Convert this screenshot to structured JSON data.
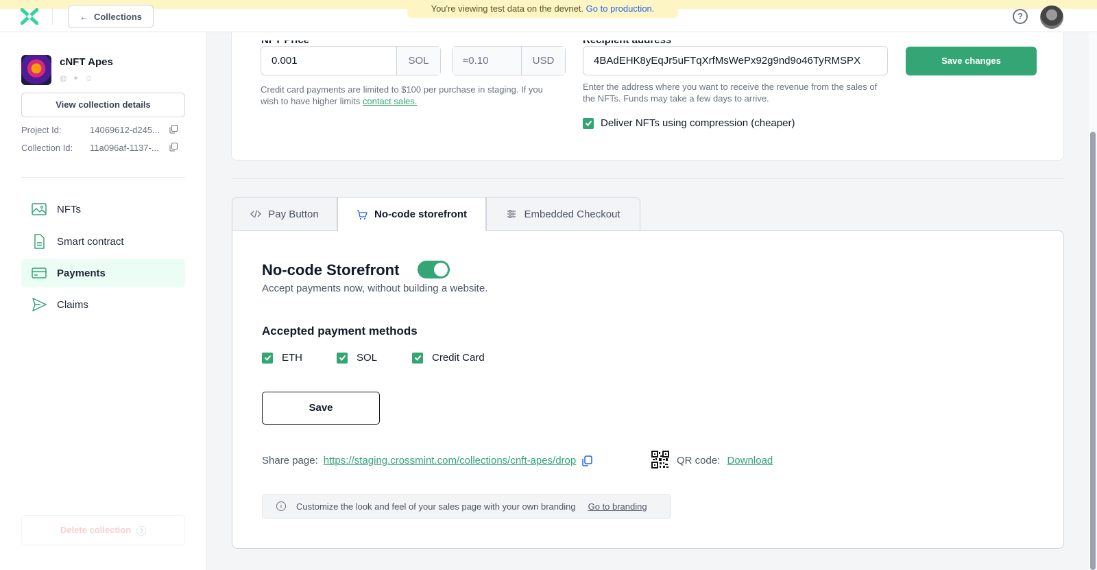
{
  "banner": {
    "text": "You're viewing test data on the devnet.",
    "link": "Go to production."
  },
  "topbar": {
    "back_label": "Collections"
  },
  "sidebar": {
    "collection_name": "cNFT Apes",
    "view_details": "View collection details",
    "project_id_label": "Project Id:",
    "project_id_value": "14069612-d245...",
    "collection_id_label": "Collection Id:",
    "collection_id_value": "11a096af-1137-...",
    "nav": [
      {
        "label": "NFTs",
        "icon": "image-icon"
      },
      {
        "label": "Smart contract",
        "icon": "document-icon"
      },
      {
        "label": "Payments",
        "icon": "credit-card-icon",
        "active": true
      },
      {
        "label": "Claims",
        "icon": "send-icon"
      }
    ],
    "delete_label": "Delete collection"
  },
  "price": {
    "price_label": "NFT Price",
    "price_value": "0.001",
    "price_unit": "SOL",
    "usd_value": "≈0.10",
    "usd_unit": "USD",
    "price_help": "Credit card payments are limited to $100 per purchase in staging. If you wish to have higher limits",
    "price_help_link": "contact sales.",
    "recipient_label": "Recipient address",
    "recipient_value": "4BAdEHK8yEqJr5uFTqXrfMsWePx92g9nd9o46TyRMSPX",
    "recipient_help": "Enter the address where you want to receive the revenue from the sales of the NFTs. Funds may take a few days to arrive.",
    "deliver_label": "Deliver NFTs using compression (cheaper)",
    "deliver_checked": true,
    "save_changes": "Save changes"
  },
  "tabs": [
    {
      "label": "Pay Button",
      "icon": "code-icon"
    },
    {
      "label": "No-code storefront",
      "icon": "cart-icon",
      "active": true
    },
    {
      "label": "Embedded Checkout",
      "icon": "sliders-icon"
    }
  ],
  "storefront": {
    "title": "No-code Storefront",
    "enabled": true,
    "subtitle": "Accept payments now, without building a website.",
    "methods_title": "Accepted payment methods",
    "methods": [
      {
        "label": "ETH",
        "checked": true
      },
      {
        "label": "SOL",
        "checked": true
      },
      {
        "label": "Credit Card",
        "checked": true
      }
    ],
    "save_label": "Save",
    "share_label": "Share page:",
    "share_url": "https://staging.crossmint.com/collections/cnft-apes/drop",
    "qr_label": "QR code:",
    "qr_link": "Download",
    "branding_text": "Customize the look and feel of your sales page with your own branding",
    "branding_link": "Go to branding"
  },
  "colors": {
    "accent": "#34a574",
    "banner": "#fdf6c4"
  }
}
